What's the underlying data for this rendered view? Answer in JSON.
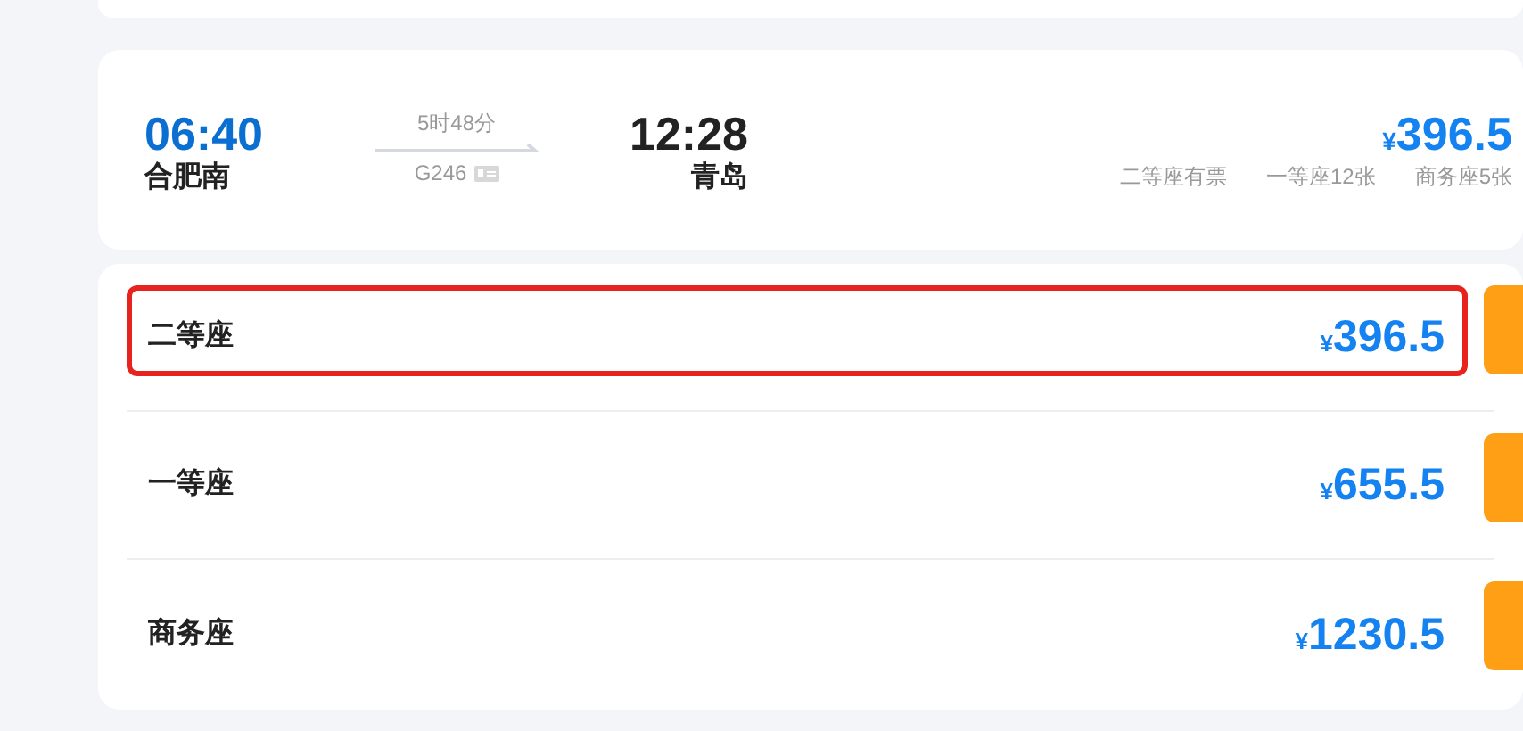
{
  "train": {
    "depart_time": "06:40",
    "depart_station": "合肥南",
    "duration": "5时48分",
    "train_no": "G246",
    "arrive_time": "12:28",
    "arrive_station": "青岛",
    "currency": "¥",
    "price": "396.5",
    "availability": [
      "二等座有票",
      "一等座12张",
      "商务座5张"
    ]
  },
  "seats": [
    {
      "name": "二等座",
      "currency": "¥",
      "price": "396.5",
      "highlighted": true
    },
    {
      "name": "一等座",
      "currency": "¥",
      "price": "655.5",
      "highlighted": false
    },
    {
      "name": "商务座",
      "currency": "¥",
      "price": "1230.5",
      "highlighted": false
    }
  ]
}
